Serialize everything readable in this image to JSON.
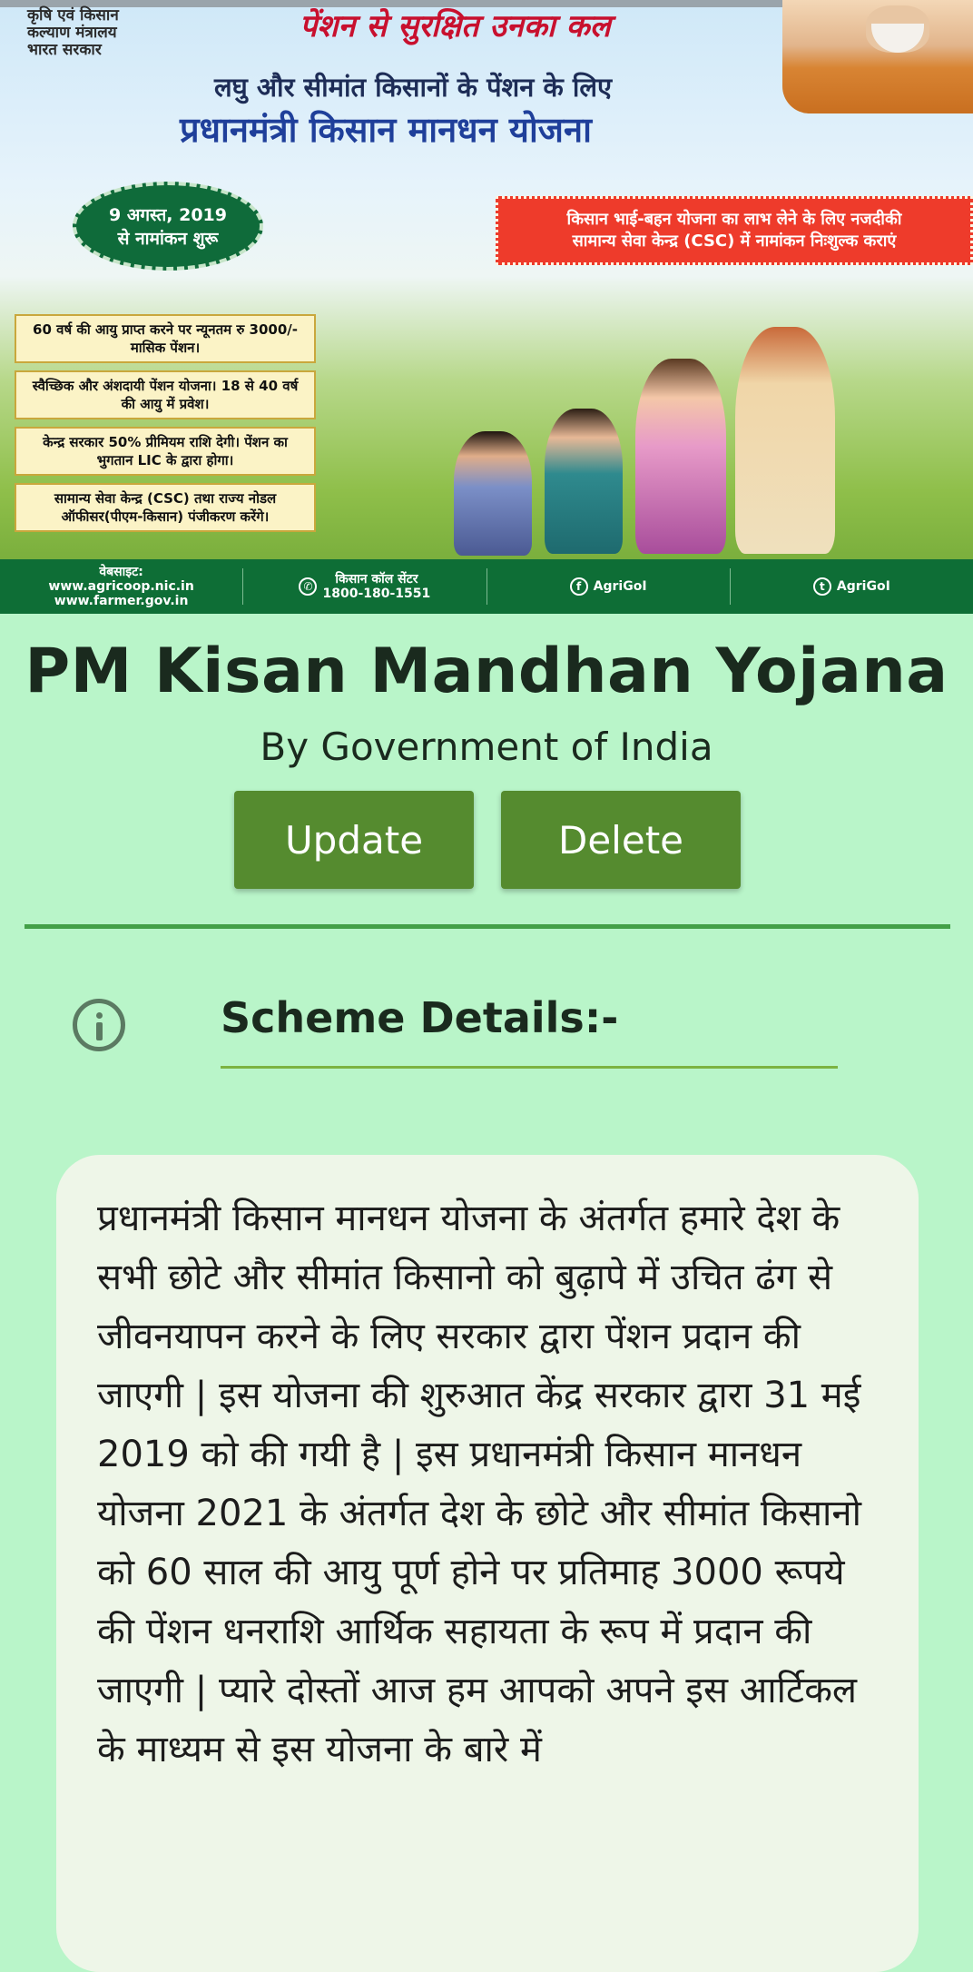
{
  "banner": {
    "ministry_lines": [
      "कृषि एवं किसान",
      "कल्याण मंत्रालय",
      "भारत सरकार"
    ],
    "headline_red": "पेंशन से सुरक्षित उनका कल",
    "headline_sub": "लघु और सीमांत किसानों के पेंशन के लिए",
    "headline_main": "प्रधानमंत्री किसान मानधन योजना",
    "seal_line1": "9 अगस्त, 2019",
    "seal_line2": "से नामांकन शुरू",
    "csc_line1": "किसान भाई-बहन योजना का लाभ लेने के लिए नजदीकी",
    "csc_line2": "सामान्य सेवा केन्द्र (CSC) में नामांकन निःशुल्क कराएं",
    "features": [
      "60 वर्ष की आयु प्राप्त करने पर न्यूनतम रु 3000/- मासिक पेंशन।",
      "स्वैच्छिक और अंशदायी पेंशन योजना। 18 से 40 वर्ष की आयु में प्रवेश।",
      "केन्द्र सरकार 50% प्रीमियम राशि देगी। पेंशन का भुगतान LIC के द्वारा होगा।",
      "सामान्य सेवा केन्द्र (CSC) तथा राज्य नोडल ऑफीसर(पीएम-किसान) पंजीकरण करेंगे।"
    ],
    "footer": {
      "website_label": "वेबसाइट:",
      "website_1": "www.agricoop.nic.in",
      "website_2": "www.farmer.gov.in",
      "call_label": "किसान कॉल सेंटर",
      "call_number": "1800-180-1551",
      "facebook": "AgriGoI",
      "twitter": "AgriGoI"
    }
  },
  "scheme": {
    "title": "PM Kisan Mandhan Yojana",
    "subtitle": "By Government of India",
    "update_label": "Update",
    "delete_label": "Delete",
    "section_title": "Scheme Details:-",
    "details": "प्रधानमंत्री किसान मानधन योजना के अंतर्गत हमारे देश के सभी छोटे और सीमांत किसानो को बुढ़ापे में उचित  ढंग से जीवनयापन करने के लिए सरकार द्वारा पेंशन प्रदान की जाएगी | इस योजना की शुरुआत केंद्र सरकार द्वारा  31 मई 2019 को की गयी है | इस प्रधानमंत्री किसान मानधन योजना 2021 के अंतर्गत देश के छोटे और सीमांत किसानो को 60 साल की आयु पूर्ण होने पर प्रतिमाह 3000 रूपये की पेंशन धनराशि आर्थिक सहायता के रूप में प्रदान की जाएगी | प्यारे दोस्तों आज हम आपको अपने इस आर्टिकल के माध्यम से इस योजना के बारे में"
  },
  "colors": {
    "background": "#b9f5c9",
    "button": "#558b2f",
    "divider": "#43a047",
    "card": "#eef6e8"
  }
}
